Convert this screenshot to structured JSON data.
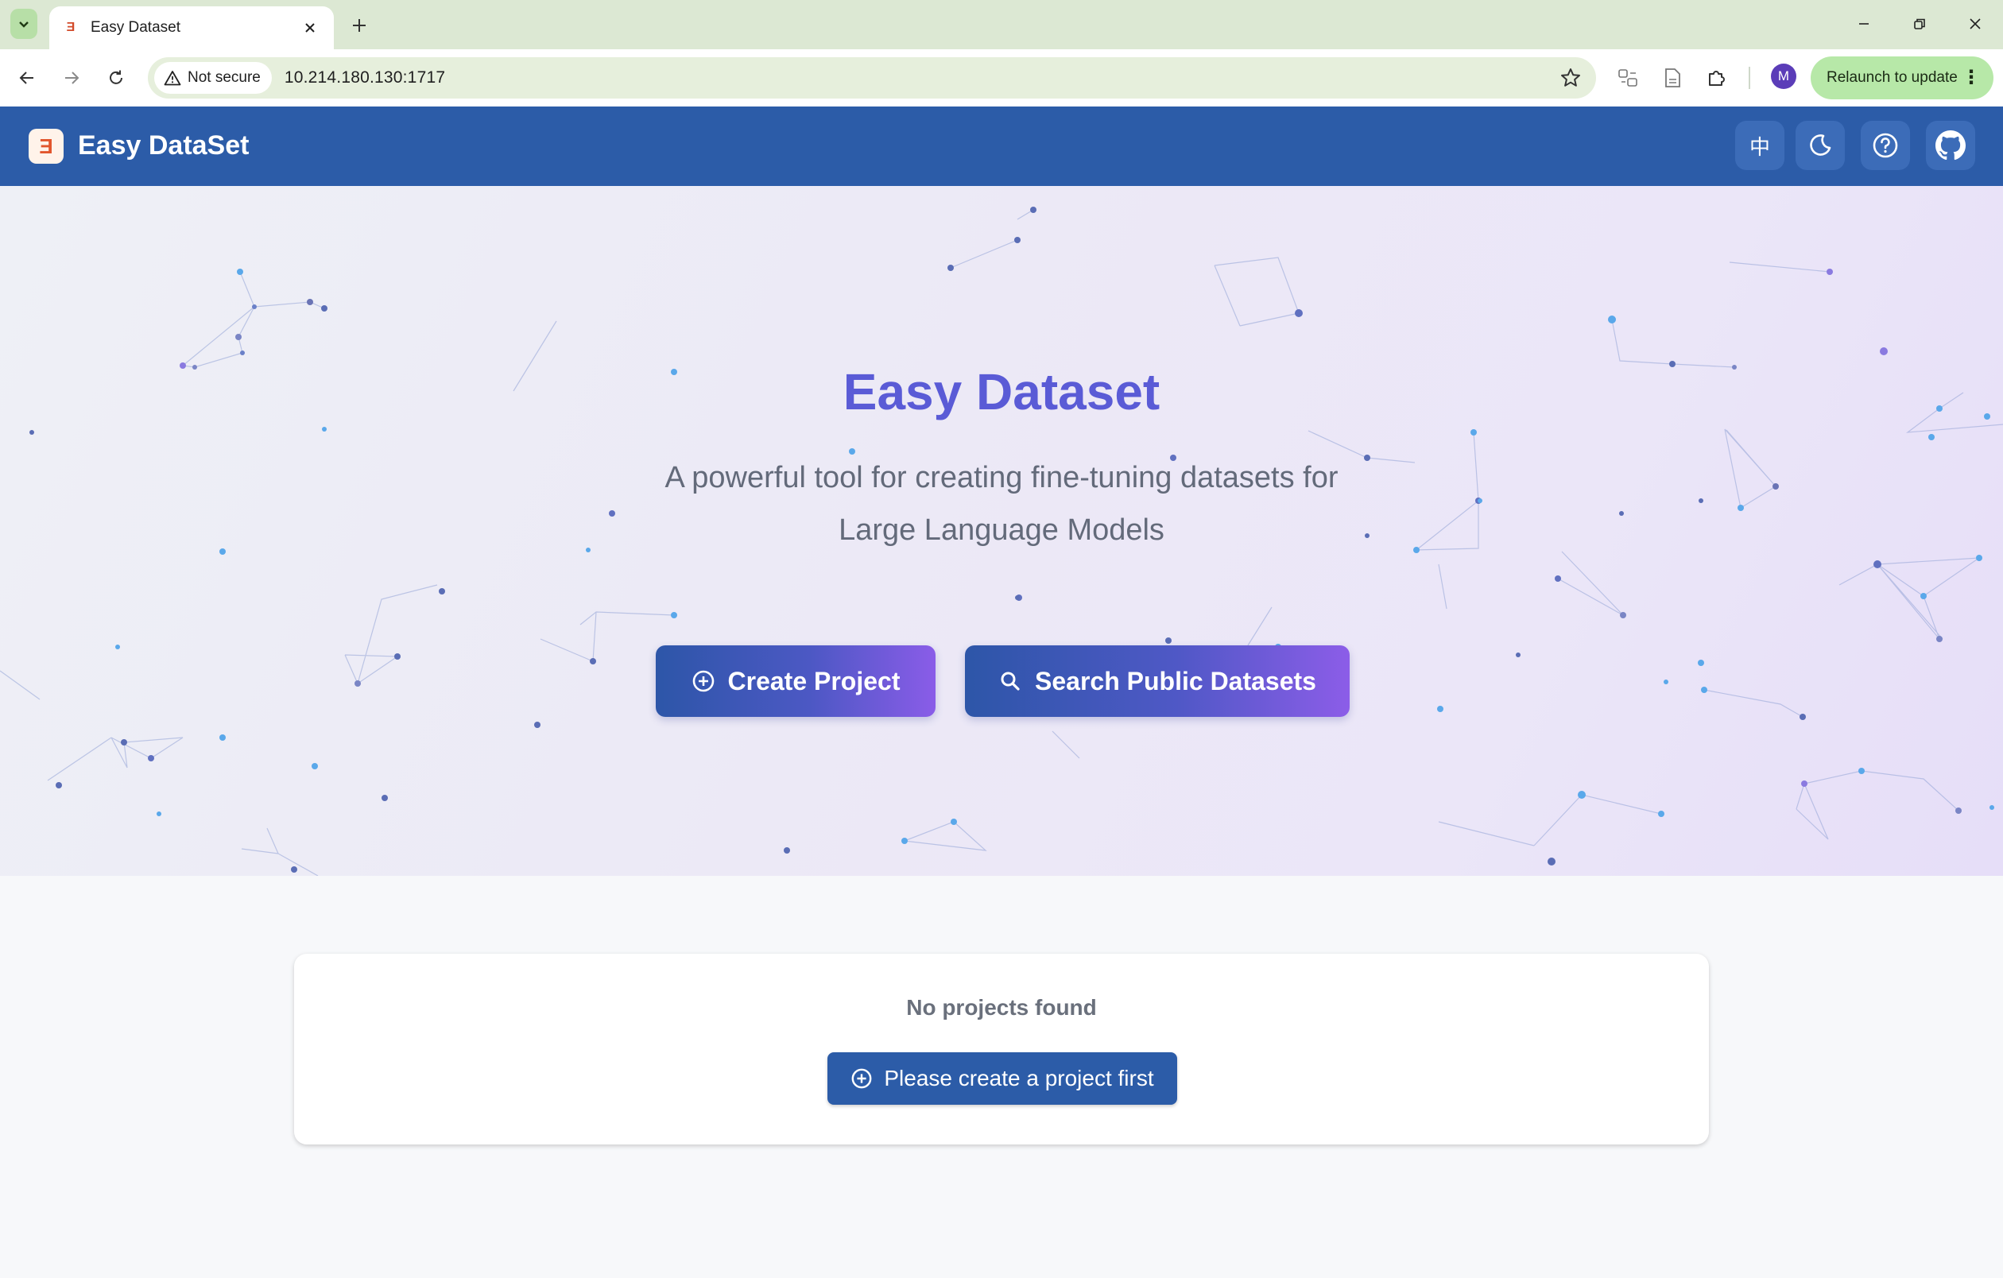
{
  "browser": {
    "tab_title": "Easy Dataset",
    "security_label": "Not secure",
    "url": "10.214.180.130:1717",
    "profile_initial": "M",
    "relaunch_label": "Relaunch to update"
  },
  "header": {
    "brand": "Easy DataSet",
    "language_toggle": "中"
  },
  "hero": {
    "title": "Easy Dataset",
    "subtitle_line1": "A powerful tool for creating fine-tuning datasets for",
    "subtitle_line2": "Large Language Models",
    "create_label": "Create Project",
    "search_label": "Search Public Datasets"
  },
  "projects": {
    "empty_text": "No projects found",
    "create_first_label": "Please create a project first"
  },
  "colors": {
    "brand_blue": "#2c5ca8",
    "hero_title": "#5a5bd6",
    "button_gradient_end": "#8a5ce8"
  }
}
